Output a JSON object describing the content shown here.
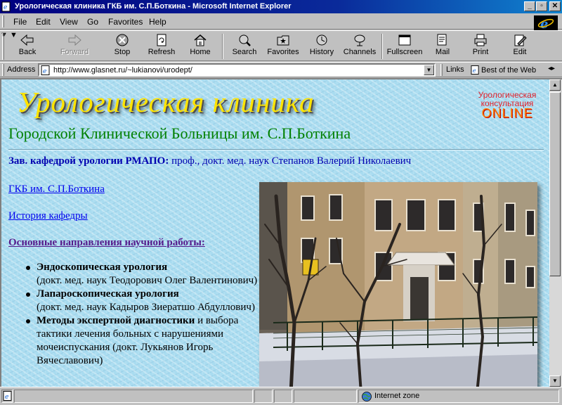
{
  "window": {
    "title": "Урологическая клиника ГКБ им. С.П.Боткина - Microsoft Internet Explorer",
    "minimize": "_",
    "maximize": "▫",
    "close": "✕"
  },
  "menu": [
    "File",
    "Edit",
    "View",
    "Go",
    "Favorites",
    "Help"
  ],
  "toolbar": {
    "back": "Back",
    "forward": "Forward",
    "stop": "Stop",
    "refresh": "Refresh",
    "home": "Home",
    "search": "Search",
    "favorites": "Favorites",
    "history": "History",
    "channels": "Channels",
    "fullscreen": "Fullscreen",
    "mail": "Mail",
    "print": "Print",
    "edit": "Edit"
  },
  "address": {
    "label": "Address",
    "url": "http://www.glasnet.ru/~lukianovi/urodept/",
    "links_label": "Links",
    "links_item": "Best of the Web"
  },
  "page": {
    "title": "Урологическая клиника",
    "consult_line1": "Урологическая",
    "consult_line2": "консультация",
    "consult_line3": "ONLINE",
    "subtitle": "Городской Клинической Больницы им. С.П.Боткина",
    "head_label": "Зав. кафедрой урологии РМАПО:",
    "head_text": "проф., докт. мед. наук Степанов Валерий Николаевич",
    "link_hospital": "ГКБ им. С.П.Боткина",
    "link_history": "История кафедры",
    "link_research": "Основные направления научной работы:",
    "directions": [
      {
        "name": "Эндоскопическая урология",
        "detail": "(докт. мед. наук Теодорович Олег Валентинович)"
      },
      {
        "name": "Лапароскопическая урология",
        "detail": "(докт. мед. наук Кадыров Зиератшо Абдуллович)"
      },
      {
        "name": "Методы экспертной диагностики",
        "detail": "и выбора тактики лечения больных с нарушениями мочеиспускания (докт. Лукьянов Игорь Вячеславович)"
      }
    ]
  },
  "status": {
    "zone": "Internet zone"
  },
  "colors": {
    "page_bg": "#a9dcf0",
    "title_yellow": "#ffe400",
    "subtitle_green": "#008000",
    "link_blue": "#0000ee",
    "visited_purple": "#551a8b"
  }
}
